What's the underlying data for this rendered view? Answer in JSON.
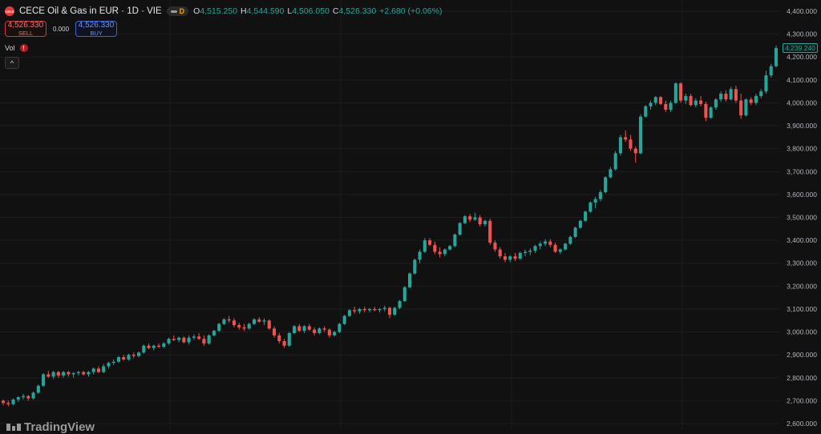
{
  "header": {
    "logo_text": "CECE",
    "title": "CECE Oil & Gas in EUR · 1D · VIE",
    "badge_letter": "D",
    "ohlc": {
      "o_label": "O",
      "o": "4,515.250",
      "h_label": "H",
      "h": "4,544.590",
      "l_label": "L",
      "l": "4,506.050",
      "c_label": "C",
      "c": "4,526.330",
      "change": "+2.680 (+0.06%)"
    }
  },
  "trade": {
    "sell_price": "4,526.330",
    "sell_label": "SELL",
    "spread": "0.000",
    "buy_price": "4,526.330",
    "buy_label": "BUY"
  },
  "volume": {
    "label": "Vol",
    "warning": "!"
  },
  "collapse_icon": "^",
  "last_price_tag": "4,239.240",
  "watermark": "TradingView",
  "colors": {
    "up": "#26a69a",
    "down": "#ef5350",
    "background": "#111111",
    "grid": "#1d1d1d",
    "axis_text": "#b2b5be"
  },
  "chart_data": {
    "type": "candlestick",
    "ylim": [
      2600,
      4400
    ],
    "yticks": [
      4400,
      4300,
      4200,
      4100,
      4000,
      3900,
      3800,
      3700,
      3600,
      3500,
      3400,
      3300,
      3200,
      3100,
      3000,
      2900,
      2800,
      2700,
      2600
    ],
    "ytick_labels": [
      "4,400.000",
      "4,300.000",
      "4,200.000",
      "4,100.000",
      "4,000.000",
      "3,900.000",
      "3,800.000",
      "3,700.000",
      "3,600.000",
      "3,500.000",
      "3,400.000",
      "3,300.000",
      "3,200.000",
      "3,100.000",
      "3,000.000",
      "2,900.000",
      "2,800.000",
      "2,700.000",
      "2,600.000"
    ],
    "last_price": 4239.24,
    "candles": [
      [
        2700,
        2705,
        2680,
        2690
      ],
      [
        2690,
        2700,
        2675,
        2685
      ],
      [
        2685,
        2710,
        2680,
        2705
      ],
      [
        2705,
        2720,
        2695,
        2715
      ],
      [
        2715,
        2730,
        2705,
        2720
      ],
      [
        2720,
        2725,
        2700,
        2710
      ],
      [
        2710,
        2740,
        2705,
        2735
      ],
      [
        2735,
        2770,
        2730,
        2765
      ],
      [
        2765,
        2820,
        2760,
        2815
      ],
      [
        2815,
        2830,
        2800,
        2805
      ],
      [
        2805,
        2830,
        2795,
        2825
      ],
      [
        2825,
        2830,
        2800,
        2810
      ],
      [
        2810,
        2830,
        2800,
        2825
      ],
      [
        2825,
        2830,
        2805,
        2815
      ],
      [
        2815,
        2825,
        2800,
        2820
      ],
      [
        2820,
        2830,
        2810,
        2825
      ],
      [
        2825,
        2830,
        2810,
        2815
      ],
      [
        2815,
        2830,
        2805,
        2825
      ],
      [
        2825,
        2845,
        2815,
        2840
      ],
      [
        2840,
        2850,
        2820,
        2825
      ],
      [
        2825,
        2860,
        2820,
        2850
      ],
      [
        2850,
        2870,
        2840,
        2865
      ],
      [
        2865,
        2880,
        2855,
        2870
      ],
      [
        2870,
        2895,
        2865,
        2890
      ],
      [
        2890,
        2900,
        2875,
        2880
      ],
      [
        2880,
        2905,
        2875,
        2900
      ],
      [
        2900,
        2910,
        2885,
        2895
      ],
      [
        2895,
        2915,
        2890,
        2910
      ],
      [
        2910,
        2945,
        2905,
        2940
      ],
      [
        2940,
        2950,
        2925,
        2930
      ],
      [
        2930,
        2945,
        2920,
        2940
      ],
      [
        2940,
        2950,
        2930,
        2935
      ],
      [
        2935,
        2955,
        2930,
        2950
      ],
      [
        2950,
        2975,
        2945,
        2970
      ],
      [
        2970,
        2985,
        2960,
        2965
      ],
      [
        2965,
        2980,
        2955,
        2975
      ],
      [
        2975,
        2980,
        2950,
        2955
      ],
      [
        2955,
        2985,
        2945,
        2975
      ],
      [
        2975,
        2990,
        2965,
        2980
      ],
      [
        2980,
        2995,
        2965,
        2970
      ],
      [
        2970,
        2985,
        2940,
        2950
      ],
      [
        2950,
        2990,
        2945,
        2985
      ],
      [
        2985,
        3010,
        2980,
        3005
      ],
      [
        3005,
        3040,
        3000,
        3035
      ],
      [
        3035,
        3060,
        3030,
        3055
      ],
      [
        3055,
        3070,
        3040,
        3050
      ],
      [
        3050,
        3060,
        3020,
        3030
      ],
      [
        3030,
        3040,
        3010,
        3020
      ],
      [
        3020,
        3035,
        3005,
        3015
      ],
      [
        3015,
        3040,
        3010,
        3035
      ],
      [
        3035,
        3060,
        3030,
        3055
      ],
      [
        3055,
        3065,
        3040,
        3045
      ],
      [
        3045,
        3060,
        3030,
        3050
      ],
      [
        3050,
        3055,
        3010,
        3015
      ],
      [
        3015,
        3025,
        2975,
        2985
      ],
      [
        2985,
        2995,
        2950,
        2960
      ],
      [
        2960,
        2970,
        2930,
        2940
      ],
      [
        2940,
        3000,
        2935,
        2995
      ],
      [
        2995,
        3030,
        2990,
        3025
      ],
      [
        3025,
        3035,
        3000,
        3005
      ],
      [
        3005,
        3030,
        2995,
        3025
      ],
      [
        3025,
        3035,
        3005,
        3010
      ],
      [
        3010,
        3020,
        2985,
        2995
      ],
      [
        2995,
        3020,
        2990,
        3015
      ],
      [
        3015,
        3025,
        3000,
        3010
      ],
      [
        3010,
        3015,
        2975,
        2985
      ],
      [
        2985,
        3005,
        2980,
        3000
      ],
      [
        3000,
        3040,
        2995,
        3035
      ],
      [
        3035,
        3075,
        3030,
        3070
      ],
      [
        3070,
        3100,
        3065,
        3095
      ],
      [
        3095,
        3110,
        3080,
        3090
      ],
      [
        3090,
        3105,
        3080,
        3100
      ],
      [
        3100,
        3110,
        3085,
        3095
      ],
      [
        3095,
        3105,
        3085,
        3100
      ],
      [
        3100,
        3110,
        3090,
        3095
      ],
      [
        3095,
        3105,
        3085,
        3100
      ],
      [
        3100,
        3115,
        3090,
        3105
      ],
      [
        3105,
        3110,
        3060,
        3075
      ],
      [
        3075,
        3110,
        3070,
        3105
      ],
      [
        3105,
        3140,
        3100,
        3135
      ],
      [
        3135,
        3200,
        3130,
        3195
      ],
      [
        3195,
        3260,
        3190,
        3255
      ],
      [
        3255,
        3320,
        3250,
        3315
      ],
      [
        3315,
        3360,
        3300,
        3350
      ],
      [
        3350,
        3410,
        3345,
        3400
      ],
      [
        3400,
        3410,
        3375,
        3380
      ],
      [
        3380,
        3395,
        3340,
        3350
      ],
      [
        3350,
        3370,
        3325,
        3340
      ],
      [
        3340,
        3365,
        3330,
        3360
      ],
      [
        3360,
        3380,
        3355,
        3375
      ],
      [
        3375,
        3430,
        3370,
        3425
      ],
      [
        3425,
        3480,
        3420,
        3475
      ],
      [
        3475,
        3510,
        3470,
        3505
      ],
      [
        3505,
        3515,
        3480,
        3490
      ],
      [
        3490,
        3520,
        3485,
        3500
      ],
      [
        3500,
        3510,
        3460,
        3470
      ],
      [
        3470,
        3490,
        3460,
        3485
      ],
      [
        3485,
        3495,
        3380,
        3390
      ],
      [
        3390,
        3400,
        3350,
        3360
      ],
      [
        3360,
        3370,
        3320,
        3330
      ],
      [
        3330,
        3345,
        3305,
        3315
      ],
      [
        3315,
        3335,
        3305,
        3330
      ],
      [
        3330,
        3345,
        3310,
        3320
      ],
      [
        3320,
        3350,
        3315,
        3345
      ],
      [
        3345,
        3360,
        3330,
        3350
      ],
      [
        3350,
        3365,
        3335,
        3355
      ],
      [
        3355,
        3380,
        3345,
        3375
      ],
      [
        3375,
        3395,
        3360,
        3385
      ],
      [
        3385,
        3405,
        3375,
        3395
      ],
      [
        3395,
        3405,
        3370,
        3380
      ],
      [
        3380,
        3390,
        3345,
        3350
      ],
      [
        3350,
        3365,
        3340,
        3360
      ],
      [
        3360,
        3390,
        3355,
        3385
      ],
      [
        3385,
        3420,
        3380,
        3415
      ],
      [
        3415,
        3460,
        3410,
        3455
      ],
      [
        3455,
        3490,
        3450,
        3485
      ],
      [
        3485,
        3530,
        3480,
        3525
      ],
      [
        3525,
        3570,
        3520,
        3565
      ],
      [
        3565,
        3590,
        3540,
        3580
      ],
      [
        3580,
        3620,
        3570,
        3610
      ],
      [
        3610,
        3680,
        3605,
        3675
      ],
      [
        3675,
        3720,
        3670,
        3710
      ],
      [
        3710,
        3790,
        3705,
        3780
      ],
      [
        3780,
        3860,
        3770,
        3850
      ],
      [
        3850,
        3880,
        3830,
        3840
      ],
      [
        3840,
        3860,
        3790,
        3800
      ],
      [
        3800,
        3810,
        3740,
        3780
      ],
      [
        3780,
        3950,
        3775,
        3940
      ],
      [
        3940,
        3990,
        3935,
        3985
      ],
      [
        3985,
        4010,
        3970,
        4000
      ],
      [
        4000,
        4030,
        3990,
        4025
      ],
      [
        4025,
        4030,
        3990,
        3995
      ],
      [
        3995,
        4010,
        3960,
        3970
      ],
      [
        3970,
        4010,
        3960,
        4000
      ],
      [
        4000,
        4090,
        3995,
        4085
      ],
      [
        4085,
        4090,
        4000,
        4010
      ],
      [
        4010,
        4040,
        3995,
        4030
      ],
      [
        4030,
        4040,
        3985,
        3990
      ],
      [
        3990,
        4020,
        3980,
        4010
      ],
      [
        4010,
        4030,
        3985,
        3995
      ],
      [
        3995,
        4005,
        3920,
        3935
      ],
      [
        3935,
        3985,
        3930,
        3980
      ],
      [
        3980,
        4020,
        3970,
        4015
      ],
      [
        4015,
        4050,
        4005,
        4040
      ],
      [
        4040,
        4055,
        4005,
        4015
      ],
      [
        4015,
        4070,
        4010,
        4060
      ],
      [
        4060,
        4075,
        4000,
        4010
      ],
      [
        4010,
        4040,
        3930,
        3945
      ],
      [
        3945,
        4020,
        3940,
        4015
      ],
      [
        4015,
        4025,
        3990,
        4000
      ],
      [
        4000,
        4040,
        3990,
        4030
      ],
      [
        4030,
        4060,
        4020,
        4050
      ],
      [
        4050,
        4140,
        4040,
        4120
      ],
      [
        4120,
        4170,
        4110,
        4160
      ],
      [
        4160,
        4250,
        4155,
        4239.24
      ]
    ]
  }
}
